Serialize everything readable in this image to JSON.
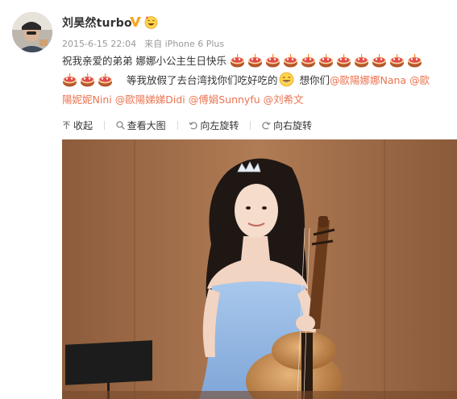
{
  "user": {
    "name": "刘昊然turbo",
    "verified_icon": "verified-v-icon",
    "emoji_badge_icon": "laughing-emoji-badge-icon"
  },
  "meta": {
    "timestamp": "2015-6-15 22:04",
    "source_prefix": "来自",
    "source": "iPhone 6 Plus"
  },
  "post": {
    "line1_text": "祝我亲爱的弟弟 娜娜小公主生日快乐",
    "line2_text_a": "等我放假了去台湾找你们吃好吃的",
    "line2_text_b": "想你们",
    "mention_nana": "@歐陽娜娜Nana",
    "mention_ou_prefix": "@歐",
    "mention_nini_rest": "陽妮妮Nini",
    "mention_didi": "@歐陽娣娣Didi",
    "mention_sunnyfu": "@傅娟Sunnyfu",
    "mention_liuxiwen": "@刘希文",
    "cake_icon": "birthday-cake-emoji-icon",
    "laugh_icon": "laughing-emoji-icon"
  },
  "actions": {
    "collapse": "收起",
    "view_large": "查看大图",
    "rotate_left": "向左旋转",
    "rotate_right": "向右旋转"
  },
  "colors": {
    "mention": "#eb7350",
    "text": "#333333",
    "meta": "#999999"
  }
}
